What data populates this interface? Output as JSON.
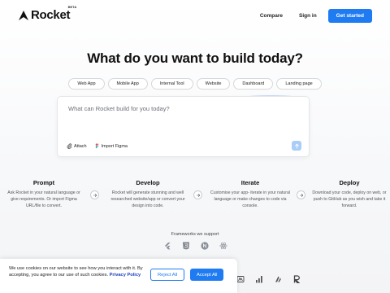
{
  "header": {
    "logo_text": "Rocket",
    "logo_badge": "BETA",
    "nav": [
      {
        "label": "Compare"
      },
      {
        "label": "Sign in"
      }
    ],
    "cta_label": "Get started"
  },
  "hero": {
    "title": "What do you want to build today?",
    "chips": [
      "Web App",
      "Mobile App",
      "Internal Tool",
      "Website",
      "Dashboard",
      "Landing page"
    ]
  },
  "prompt": {
    "placeholder": "What can Rocket build for you today?",
    "value": "",
    "actions": [
      {
        "label": "Attach",
        "icon": "paperclip-icon"
      },
      {
        "label": "Import Figma",
        "icon": "figma-icon"
      }
    ],
    "send_icon": "arrow-up-icon"
  },
  "steps": [
    {
      "title": "Prompt",
      "desc": "Ask Rocket in your natural language or give requirements. Or import Figma URL/file to convert."
    },
    {
      "title": "Develop",
      "desc": "Rocket will generate stunning and well researched website/app or convert your design into code."
    },
    {
      "title": "Iterate",
      "desc": "Customise your app- iterate in your natural language or make changes to code via console."
    },
    {
      "title": "Deploy",
      "desc": "Download your code, deploy on web, or push to GitHub as you wish and take it forward."
    }
  ],
  "frameworks": {
    "label": "Frameworks we support",
    "icons": [
      "flutter-icon",
      "html5-icon",
      "nextjs-icon",
      "react-icon"
    ],
    "icons_row2": [
      "tailwind-icon",
      "chart-icon",
      "supabase-icon",
      "r-icon"
    ]
  },
  "cookie": {
    "text": "We use cookies on our website to see how you interact with it. By accepting, you agree to our use of such cookies.",
    "link": "Privacy Policy",
    "reject_label": "Reject All",
    "accept_label": "Accept All"
  },
  "colors": {
    "accent": "#1e7bf2",
    "send_button": "#a9cdf6"
  }
}
